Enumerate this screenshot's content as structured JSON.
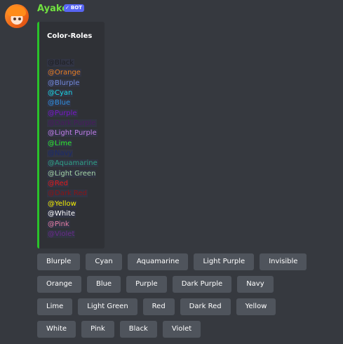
{
  "message": {
    "author": "Ayako",
    "bot_tag": "BOT",
    "author_color": "#70e040"
  },
  "embed": {
    "title": "Color-Roles",
    "accent_color": "#2ac22a",
    "roles": [
      {
        "label": "@Black",
        "color": "#1e1f22"
      },
      {
        "label": "@Orange",
        "color": "#e67e22"
      },
      {
        "label": "@Blurple",
        "color": "#7289da"
      },
      {
        "label": "@Cyan",
        "color": "#1bd9e6"
      },
      {
        "label": "@Blue",
        "color": "#2f8fe0"
      },
      {
        "label": "@Purple",
        "color": "#7a17c9"
      },
      {
        "label": "@Dark Purple",
        "color": "#4a1a5e"
      },
      {
        "label": "@Light Purple",
        "color": "#c27ee8"
      },
      {
        "label": "@Lime",
        "color": "#2ef02e"
      },
      {
        "label": "@Navy",
        "color": "#1b2a6b"
      },
      {
        "label": "@Aquamarine",
        "color": "#2fa387"
      },
      {
        "label": "@Light Green",
        "color": "#a5d6a7"
      },
      {
        "label": "@Red",
        "color": "#e01b1b"
      },
      {
        "label": "@Dark Red",
        "color": "#8b1414"
      },
      {
        "label": "@Yellow",
        "color": "#f5f000"
      },
      {
        "label": "@White",
        "color": "#ffffff"
      },
      {
        "label": "@Pink",
        "color": "#e87fa6"
      },
      {
        "label": "@Violet",
        "color": "#6b2a8a"
      }
    ]
  },
  "buttons": [
    [
      "Blurple",
      "Cyan",
      "Aquamarine",
      "Light Purple",
      "Invisible"
    ],
    [
      "Orange",
      "Blue",
      "Purple",
      "Dark Purple",
      "Navy"
    ],
    [
      "Lime",
      "Light Green",
      "Red",
      "Dark Red",
      "Yellow"
    ],
    [
      "White",
      "Pink",
      "Black",
      "Violet"
    ]
  ],
  "colors": {
    "background": "#36393f",
    "embed_background": "#2f3136",
    "button_background": "#4f545c",
    "bot_tag": "#5865f2"
  }
}
